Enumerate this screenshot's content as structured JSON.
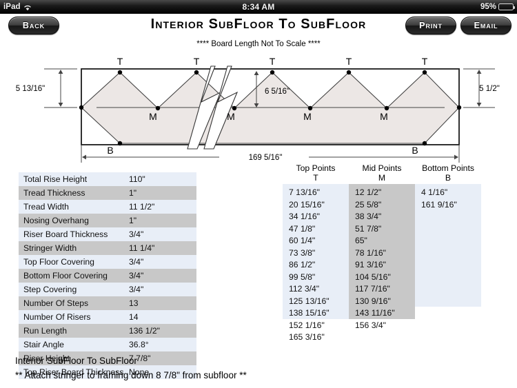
{
  "statusbar": {
    "carrier": "iPad",
    "wifi_icon": "wifi-icon",
    "time": "8:34 AM",
    "battery_pct": "95%",
    "battery_level": 95
  },
  "toolbar": {
    "back_label": "Back",
    "print_label": "Print",
    "email_label": "Email",
    "title": "Interior SubFloor To SubFloor"
  },
  "diagram": {
    "notice": "**** Board Length Not To Scale ****",
    "left_rise_label": "5 13/16\"",
    "right_rise_label": "5 1/2\"",
    "mid_rise_label": "6 5/16\"",
    "run_label": "169 5/16\"",
    "marker_top": "T",
    "marker_mid": "M",
    "marker_bottom": "B",
    "board_fill": "#ece7e5",
    "board_stroke": "#1a1a1a"
  },
  "specs": {
    "rows": [
      {
        "label": "Total Rise Height",
        "value": "110\""
      },
      {
        "label": "Tread Thickness",
        "value": "1\""
      },
      {
        "label": "Tread Width",
        "value": "11 1/2\""
      },
      {
        "label": "Nosing Overhang",
        "value": "1\""
      },
      {
        "label": "Riser Board Thickness",
        "value": "3/4\""
      },
      {
        "label": "Stringer Width",
        "value": "11 1/4\""
      },
      {
        "label": "Top Floor Covering",
        "value": "3/4\""
      },
      {
        "label": "Bottom Floor Covering",
        "value": "3/4\""
      },
      {
        "label": "Step Covering",
        "value": "3/4\""
      },
      {
        "label": "Number Of Steps",
        "value": "13"
      },
      {
        "label": "Number Of Risers",
        "value": "14"
      },
      {
        "label": "Run Length",
        "value": "136 1/2\""
      },
      {
        "label": "Stair Angle",
        "value": "36.8°"
      },
      {
        "label": "Riser Height",
        "value": "7 7/8\""
      },
      {
        "label": "Top Riser Board Thickness",
        "value": "None"
      }
    ]
  },
  "points": {
    "top": {
      "header": "Top Points",
      "symbol": "T",
      "values": [
        "7 13/16\"",
        "20 15/16\"",
        "34 1/16\"",
        "47 1/8\"",
        "60 1/4\"",
        "73 3/8\"",
        "86 1/2\"",
        "99 5/8\"",
        "112 3/4\"",
        "125 13/16\"",
        "138 15/16\"",
        "152 1/16\"",
        "165 3/16\""
      ]
    },
    "mid": {
      "header": "Mid Points",
      "symbol": "M",
      "values": [
        "12 1/2\"",
        "25 5/8\"",
        "38 3/4\"",
        "51 7/8\"",
        "65\"",
        "78 1/16\"",
        "91 3/16\"",
        "104 5/16\"",
        "117 7/16\"",
        "130 9/16\"",
        "143 11/16\"",
        "156 3/4\""
      ]
    },
    "bottom": {
      "header": "Bottom Points",
      "symbol": "B",
      "values": [
        "4 1/16\"",
        "161 9/16\""
      ]
    }
  },
  "footer": {
    "line1": "Interior SubFloor To SubFloor",
    "line2": "** Attach stringer to framing down 8 7/8\" from subfloor **"
  }
}
